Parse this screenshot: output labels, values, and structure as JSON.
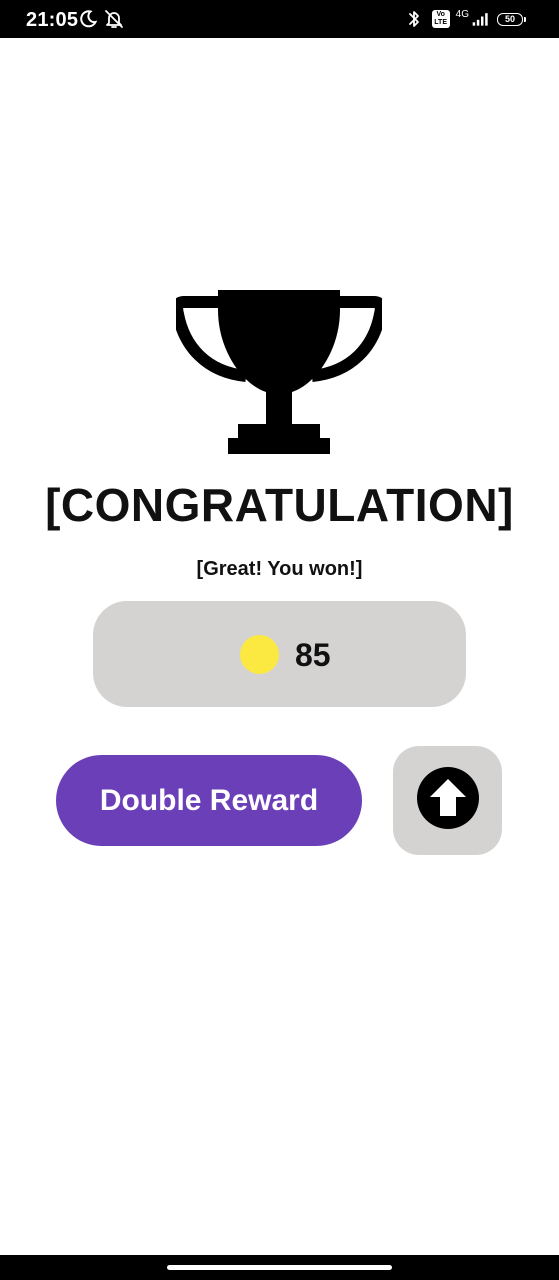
{
  "status_bar": {
    "time": "21:05",
    "left_icons": [
      "moon-icon",
      "bell-off-icon"
    ],
    "right_icons": [
      "bluetooth-icon",
      "volte-icon",
      "signal-4g-icon"
    ],
    "volte_label": "Vo LTE",
    "network_label": "4G",
    "battery_level": "50"
  },
  "main": {
    "trophy_icon": "trophy-icon",
    "title": "[CONGRATULATION]",
    "subtitle": "[Great! You won!]",
    "reward": {
      "coin_icon": "coin-icon",
      "coin_color": "#fbe941",
      "amount": "85"
    },
    "double_reward_label": "Double Reward",
    "upgrade_icon": "arrow-up-circle-icon"
  },
  "colors": {
    "accent_purple": "#6b3fb8",
    "panel_gray": "#d4d3d2"
  }
}
